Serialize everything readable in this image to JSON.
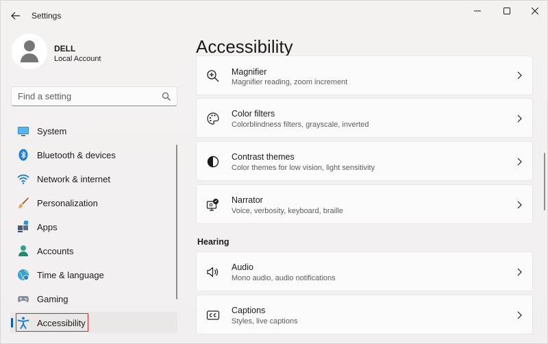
{
  "window": {
    "title": "Settings"
  },
  "profile": {
    "name": "DELL",
    "account_type": "Local Account"
  },
  "search": {
    "placeholder": "Find a setting"
  },
  "sidebar": {
    "items": [
      {
        "label": "System",
        "icon": "system-icon"
      },
      {
        "label": "Bluetooth & devices",
        "icon": "bluetooth-icon"
      },
      {
        "label": "Network & internet",
        "icon": "wifi-icon"
      },
      {
        "label": "Personalization",
        "icon": "brush-icon"
      },
      {
        "label": "Apps",
        "icon": "apps-icon"
      },
      {
        "label": "Accounts",
        "icon": "accounts-icon"
      },
      {
        "label": "Time & language",
        "icon": "globe-icon"
      },
      {
        "label": "Gaming",
        "icon": "gamepad-icon"
      },
      {
        "label": "Accessibility",
        "icon": "accessibility-icon",
        "active": true
      }
    ]
  },
  "main": {
    "title": "Accessibility",
    "vision_items": [
      {
        "title": "Magnifier",
        "subtitle": "Magnifier reading, zoom increment",
        "icon": "magnifier-icon"
      },
      {
        "title": "Color filters",
        "subtitle": "Colorblindness filters, grayscale, inverted",
        "icon": "palette-icon"
      },
      {
        "title": "Contrast themes",
        "subtitle": "Color themes for low vision, light sensitivity",
        "icon": "contrast-icon"
      },
      {
        "title": "Narrator",
        "subtitle": "Voice, verbosity, keyboard, braille",
        "icon": "narrator-icon"
      }
    ],
    "hearing_heading": "Hearing",
    "hearing_items": [
      {
        "title": "Audio",
        "subtitle": "Mono audio, audio notifications",
        "icon": "speaker-icon"
      },
      {
        "title": "Captions",
        "subtitle": "Styles, live captions",
        "icon": "captions-icon"
      }
    ]
  },
  "colors": {
    "accent": "#005fb8",
    "highlight": "#d9262a",
    "card_bg": "#fbfbfb",
    "window_bg": "#f3f1f0"
  }
}
